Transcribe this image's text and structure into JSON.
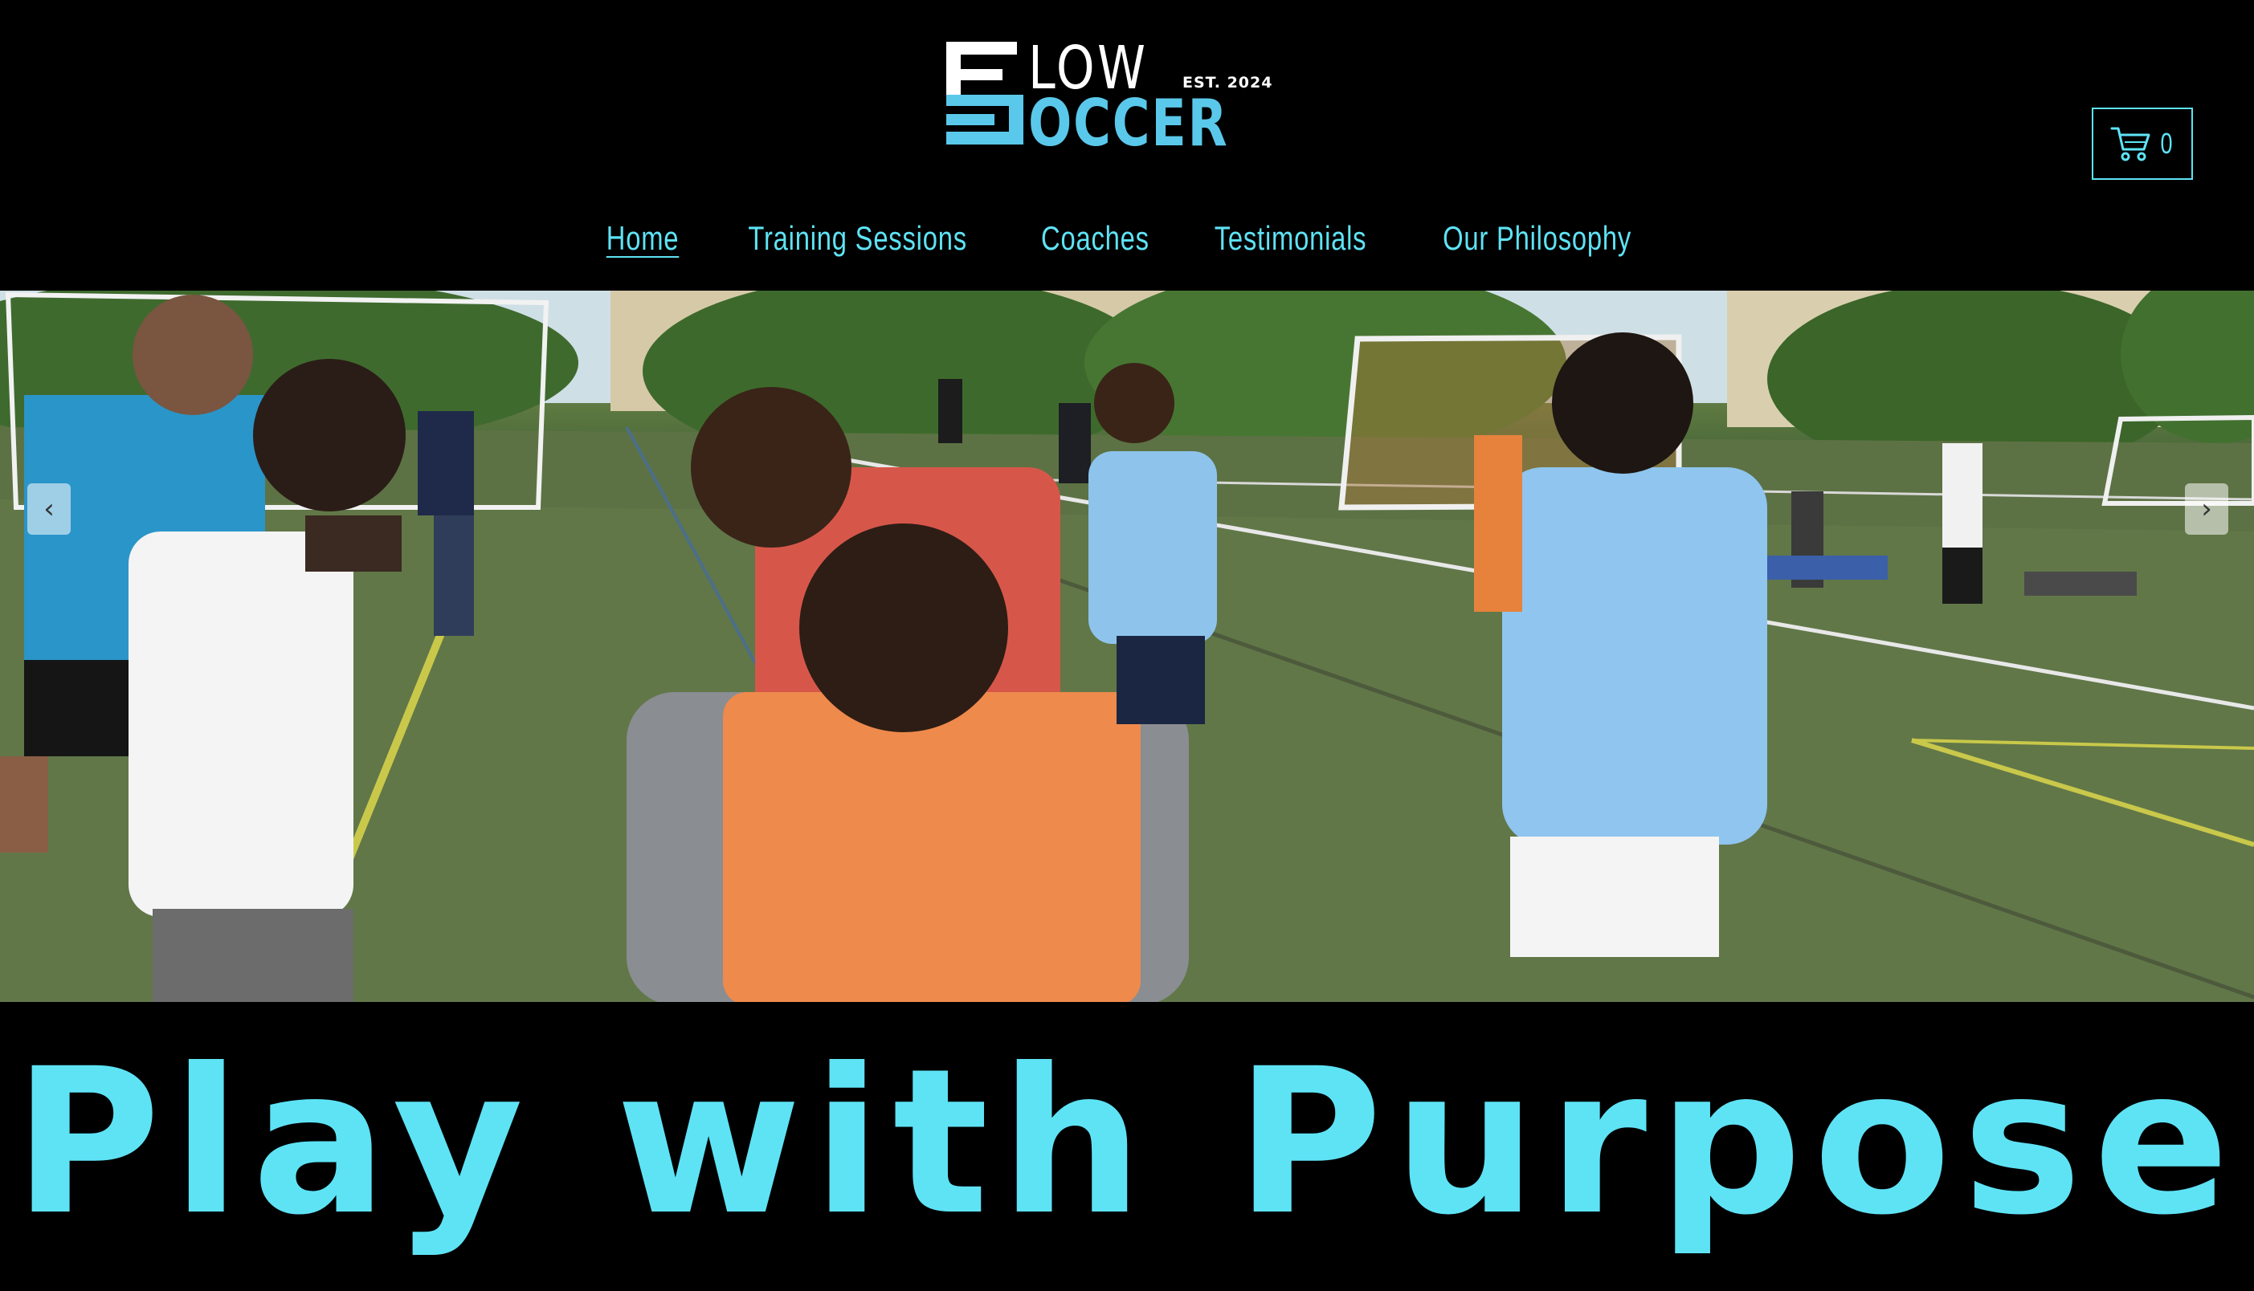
{
  "brand": {
    "word_top_rest": "LOW",
    "word_bottom_rest": "OCCER",
    "established": "EST. 2024",
    "primary_color": "#5ac8ea",
    "accent_color": "#5ee3f5"
  },
  "cart": {
    "icon": "shopping-cart-icon",
    "count": "0"
  },
  "nav": {
    "items": [
      {
        "label": "Home",
        "active": true
      },
      {
        "label": "Training Sessions",
        "active": false
      },
      {
        "label": "Coaches",
        "active": false
      },
      {
        "label": "Testimonials",
        "active": false
      },
      {
        "label": "Our Philosophy",
        "active": false
      }
    ]
  },
  "slideshow": {
    "prev_icon": "chevron-left-icon",
    "next_icon": "chevron-right-icon",
    "prev_glyph": "‹",
    "next_glyph": "›"
  },
  "tagline": "Play with Purpose"
}
